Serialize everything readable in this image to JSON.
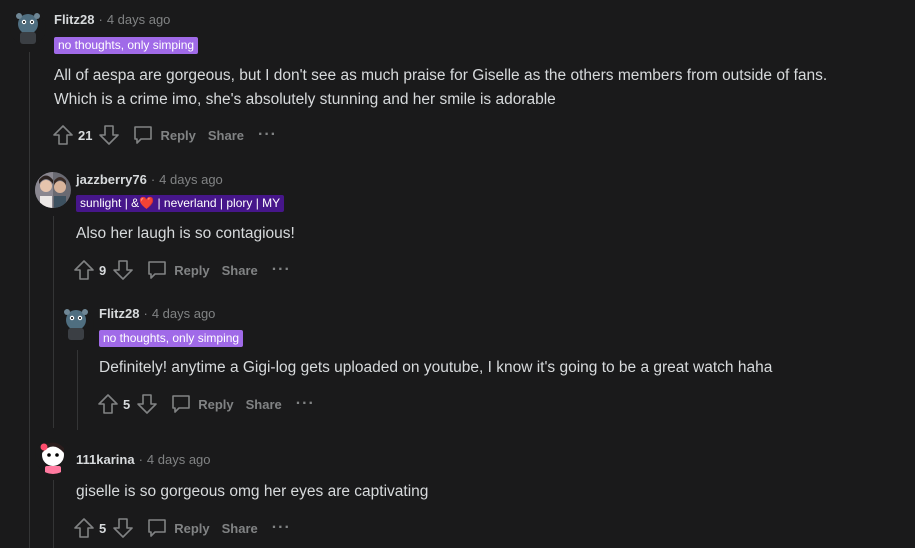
{
  "comments": [
    {
      "username": "Flitz28",
      "time": "4 days ago",
      "flair": "no thoughts, only simping",
      "body_line1": "All of aespa are gorgeous, but I don't see as much praise for Giselle as the others members from outside of fans.",
      "body_line2": "Which is a crime imo, she's absolutely stunning and her smile is adorable",
      "votes": "21",
      "reply_label": "Reply",
      "share_label": "Share",
      "more_label": "···"
    },
    {
      "username": "jazzberry76",
      "time": "4 days ago",
      "flair_part1": "sunlight | &",
      "flair_heart": "❤️",
      "flair_part2": " | neverland | plory | MY",
      "body_line1": "Also her laugh is so contagious!",
      "votes": "9",
      "reply_label": "Reply",
      "share_label": "Share",
      "more_label": "···"
    },
    {
      "username": "Flitz28",
      "time": "4 days ago",
      "flair": "no thoughts, only simping",
      "body_line1": "Definitely! anytime a Gigi-log gets uploaded on youtube, I know it's going to be a great watch haha",
      "votes": "5",
      "reply_label": "Reply",
      "share_label": "Share",
      "more_label": "···"
    },
    {
      "username": "111karina",
      "time": "4 days ago",
      "body_line1": "giselle is so gorgeous omg her eyes are captivating",
      "votes": "5",
      "reply_label": "Reply",
      "share_label": "Share",
      "more_label": "···"
    }
  ],
  "separator": "·",
  "colors": {
    "background": "#1a1a1b",
    "text": "#d7dadc",
    "muted": "#818384",
    "flair_purple": "#a06ae8",
    "flair_violet": "#46168a",
    "thread_line": "#343536"
  }
}
